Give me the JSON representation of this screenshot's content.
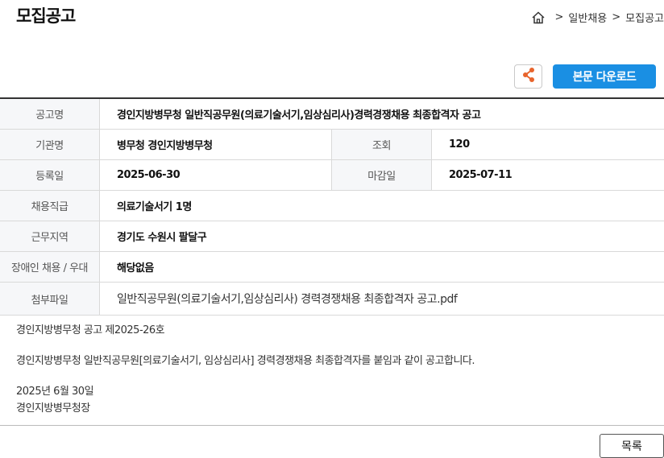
{
  "page": {
    "title": "모집공고"
  },
  "breadcrumb": {
    "home_icon": "home-icon",
    "items": [
      "일반채용",
      "모집공고"
    ],
    "separator": ">"
  },
  "toolbar": {
    "share_icon": "share-icon",
    "download_label": "본문 다운로드"
  },
  "info": {
    "title_label": "공고명",
    "title_value": "경인지방병무청 일반직공무원(의료기술서기,임상심리사)경력경쟁채용 최종합격자 공고",
    "agency_label": "기관명",
    "agency_value": "병무청 경인지방병무청",
    "views_label": "조회",
    "views_value": "120",
    "reg_label": "등록일",
    "reg_value": "2025-06-30",
    "deadline_label": "마감일",
    "deadline_value": "2025-07-11",
    "grade_label": "채용직급",
    "grade_value": "의료기술서기 1명",
    "location_label": "근무지역",
    "location_value": "경기도 수원시 팔달구",
    "disability_label": "장애인 채용 / 우대",
    "disability_value": "해당없음",
    "attachment_label": "첨부파일",
    "attachment_value": "일반직공무원(의료기술서기,임상심리사) 경력경쟁채용 최종합격자 공고.pdf"
  },
  "body": {
    "line1": "경인지방병무청 공고 제2025-26호",
    "line2": "경인지방병무청 일반직공무원[의료기술서기, 임상심리사] 경력경쟁채용 최종합격자를 붙임과 같이 공고합니다.",
    "line3": "2025년 6월 30일",
    "line4": "경인지방병무청장"
  },
  "footer": {
    "list_label": "목록"
  }
}
